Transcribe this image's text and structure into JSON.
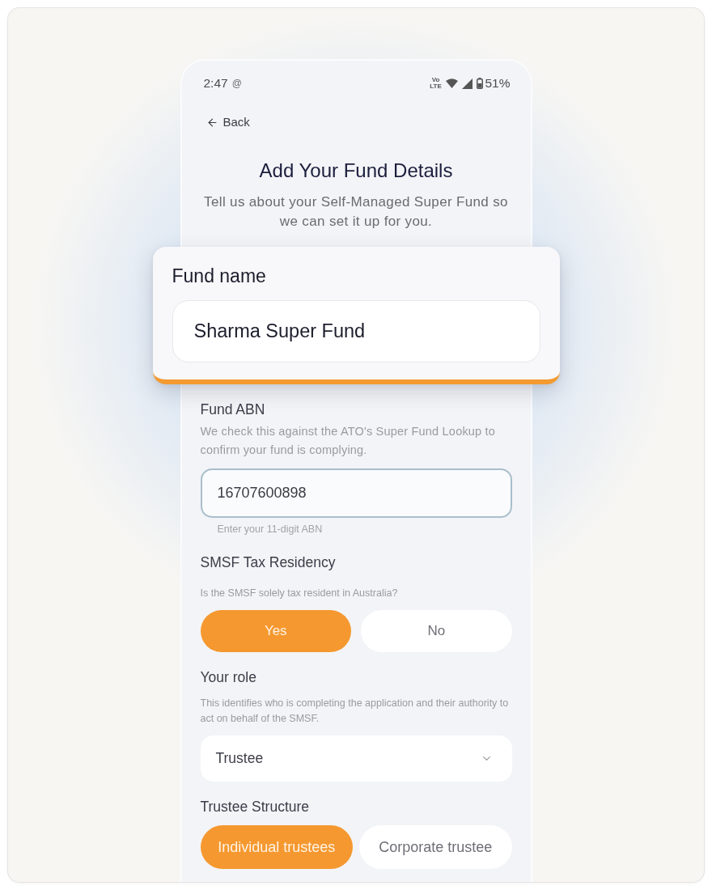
{
  "status_bar": {
    "time": "2:47",
    "indicator": "@",
    "network": "Vo LTE",
    "battery": "51%"
  },
  "back": {
    "label": "Back"
  },
  "header": {
    "title": "Add Your Fund Details",
    "subtitle": "Tell us about your Self-Managed Super Fund so we can set it up for you."
  },
  "highlight_card": {
    "label": "Fund name",
    "value": "Sharma Super Fund"
  },
  "fields": [
    {
      "kind": "input",
      "label": "Fund ABN",
      "description": "We check this against the ATO's Super Fund Lookup to confirm your fund is complying.",
      "value": "16707600898",
      "focused": true,
      "hint": "Enter your 11-digit ABN"
    },
    {
      "kind": "choice",
      "label": "SMSF Tax Residency",
      "description": "Is the SMSF solely tax resident in Australia?",
      "options": [
        {
          "label": "Yes",
          "selected": true
        },
        {
          "label": "No",
          "selected": false
        }
      ]
    },
    {
      "kind": "select",
      "label": "Your role",
      "description": "This identifies who is completing the application and their authority to act on behalf of the SMSF.",
      "value": "Trustee"
    },
    {
      "kind": "choice",
      "label": "Trustee Structure",
      "options": [
        {
          "label": "Individual trustees",
          "selected": true
        },
        {
          "label": "Corporate trustee",
          "selected": false
        }
      ]
    }
  ]
}
